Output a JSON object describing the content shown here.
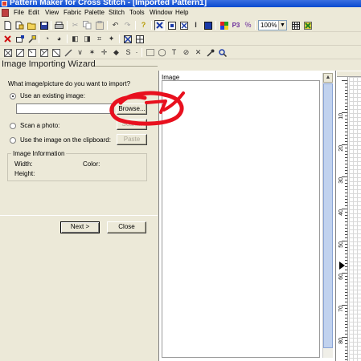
{
  "window": {
    "title": "Pattern Maker for Cross Stitch - [Imported Pattern1]"
  },
  "menu": [
    "File",
    "Edit",
    "View",
    "Fabric",
    "Palette",
    "Stitch",
    "Tools",
    "Window",
    "Help"
  ],
  "toolbar": {
    "zoom_value": "100%"
  },
  "wizard": {
    "header": "Image Importing Wizard",
    "question": "What image/picture do you want to import?",
    "option_existing": "Use an existing image:",
    "path_value": "",
    "browse_label": "Browse...",
    "option_scan": "Scan a photo:",
    "scan_label": "Scan...",
    "option_clipboard": "Use the image on the clipboard:",
    "paste_label": "Paste",
    "info_title": "Image Information",
    "width_label": "Width:",
    "color_label": "Color:",
    "height_label": "Height:",
    "next_label": "Next >",
    "close_label": "Close"
  },
  "image_panel": {
    "label": "Image"
  },
  "ruler": {
    "labels": [
      "10",
      "20",
      "30",
      "40",
      "50",
      "60",
      "70",
      "80"
    ]
  },
  "colors": {
    "annotation": "#e8101e",
    "title_bar": "#0a4ad0",
    "chrome": "#ece9d8"
  }
}
